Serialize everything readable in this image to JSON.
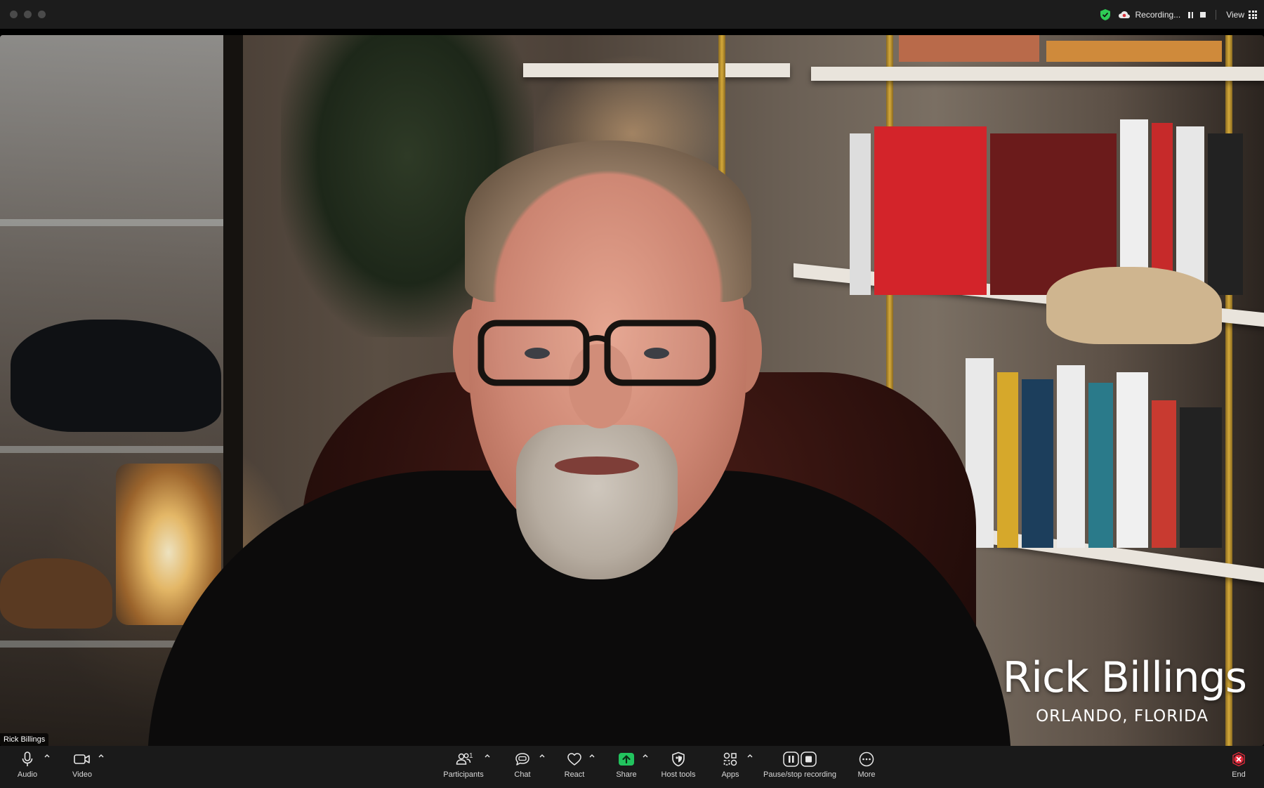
{
  "window": {
    "recording_label": "Recording...",
    "view_label": "View"
  },
  "stage": {
    "participant_name_tag": "Rick Billings",
    "lower_third": {
      "name": "Rick Billings",
      "location": "ORLANDO, FLORIDA"
    }
  },
  "toolbar": {
    "audio": "Audio",
    "video": "Video",
    "participants": "Participants",
    "participants_count": "1",
    "chat": "Chat",
    "react": "React",
    "share": "Share",
    "host_tools": "Host tools",
    "apps": "Apps",
    "recording": "Pause/stop recording",
    "more": "More",
    "end": "End"
  },
  "colors": {
    "encryption_shield": "#2ecc55",
    "share_green": "#22c35e",
    "end_red": "#e5293b",
    "toolbar_bg": "#1a1a1a"
  }
}
